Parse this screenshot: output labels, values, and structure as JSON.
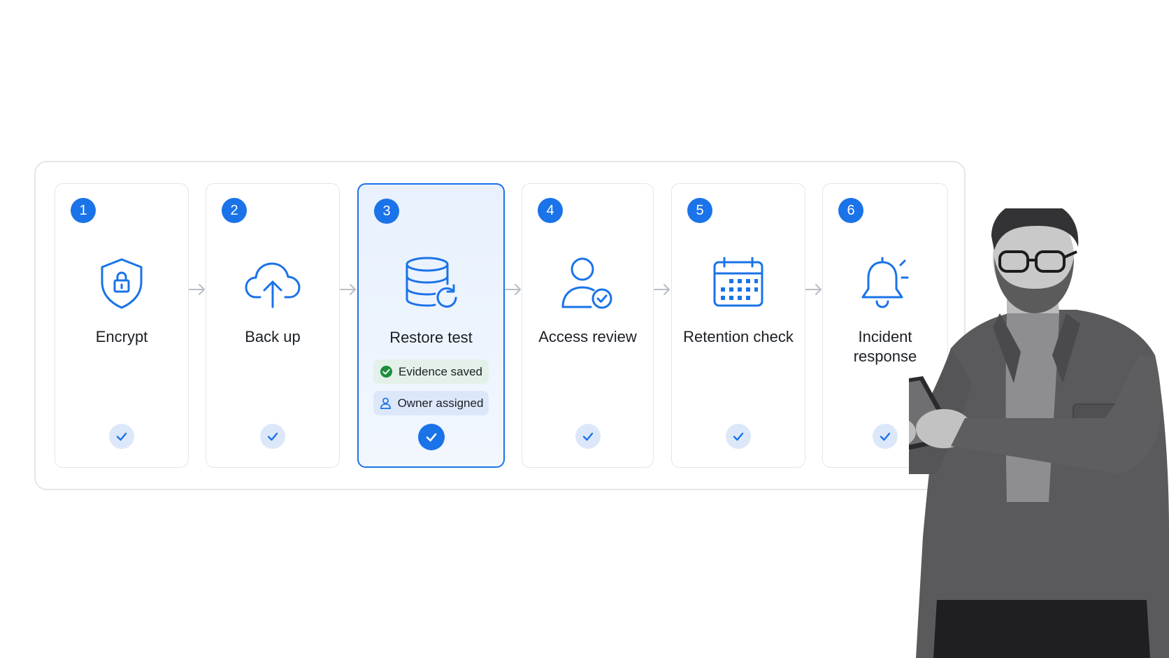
{
  "accent_color": "#1a73e8",
  "steps": [
    {
      "number": "1",
      "label": "Encrypt",
      "icon": "shield-lock-icon",
      "status_icon": "check-icon"
    },
    {
      "number": "2",
      "label": "Back up",
      "icon": "cloud-upload-icon",
      "status_icon": "check-icon"
    },
    {
      "number": "3",
      "label": "Restore test",
      "icon": "database-restore-icon",
      "status_icon": "check-icon",
      "active": true,
      "chips": [
        {
          "label": "Evidence saved",
          "icon": "check-circle-icon",
          "color": "#1e8e3e"
        },
        {
          "label": "Owner assigned",
          "icon": "user-icon",
          "color": "#1a73e8"
        }
      ]
    },
    {
      "number": "4",
      "label": "Access review",
      "icon": "user-check-icon",
      "status_icon": "check-icon"
    },
    {
      "number": "5",
      "label": "Retention check",
      "icon": "calendar-icon",
      "status_icon": "check-icon"
    },
    {
      "number": "6",
      "label": "Incident\nresponse",
      "label_lines": [
        "Incident",
        "response"
      ],
      "icon": "bell-alert-icon",
      "status_icon": "check-icon"
    }
  ],
  "connector_icon": "arrow-right-icon",
  "photo": {
    "subject": "person-with-tablet"
  }
}
